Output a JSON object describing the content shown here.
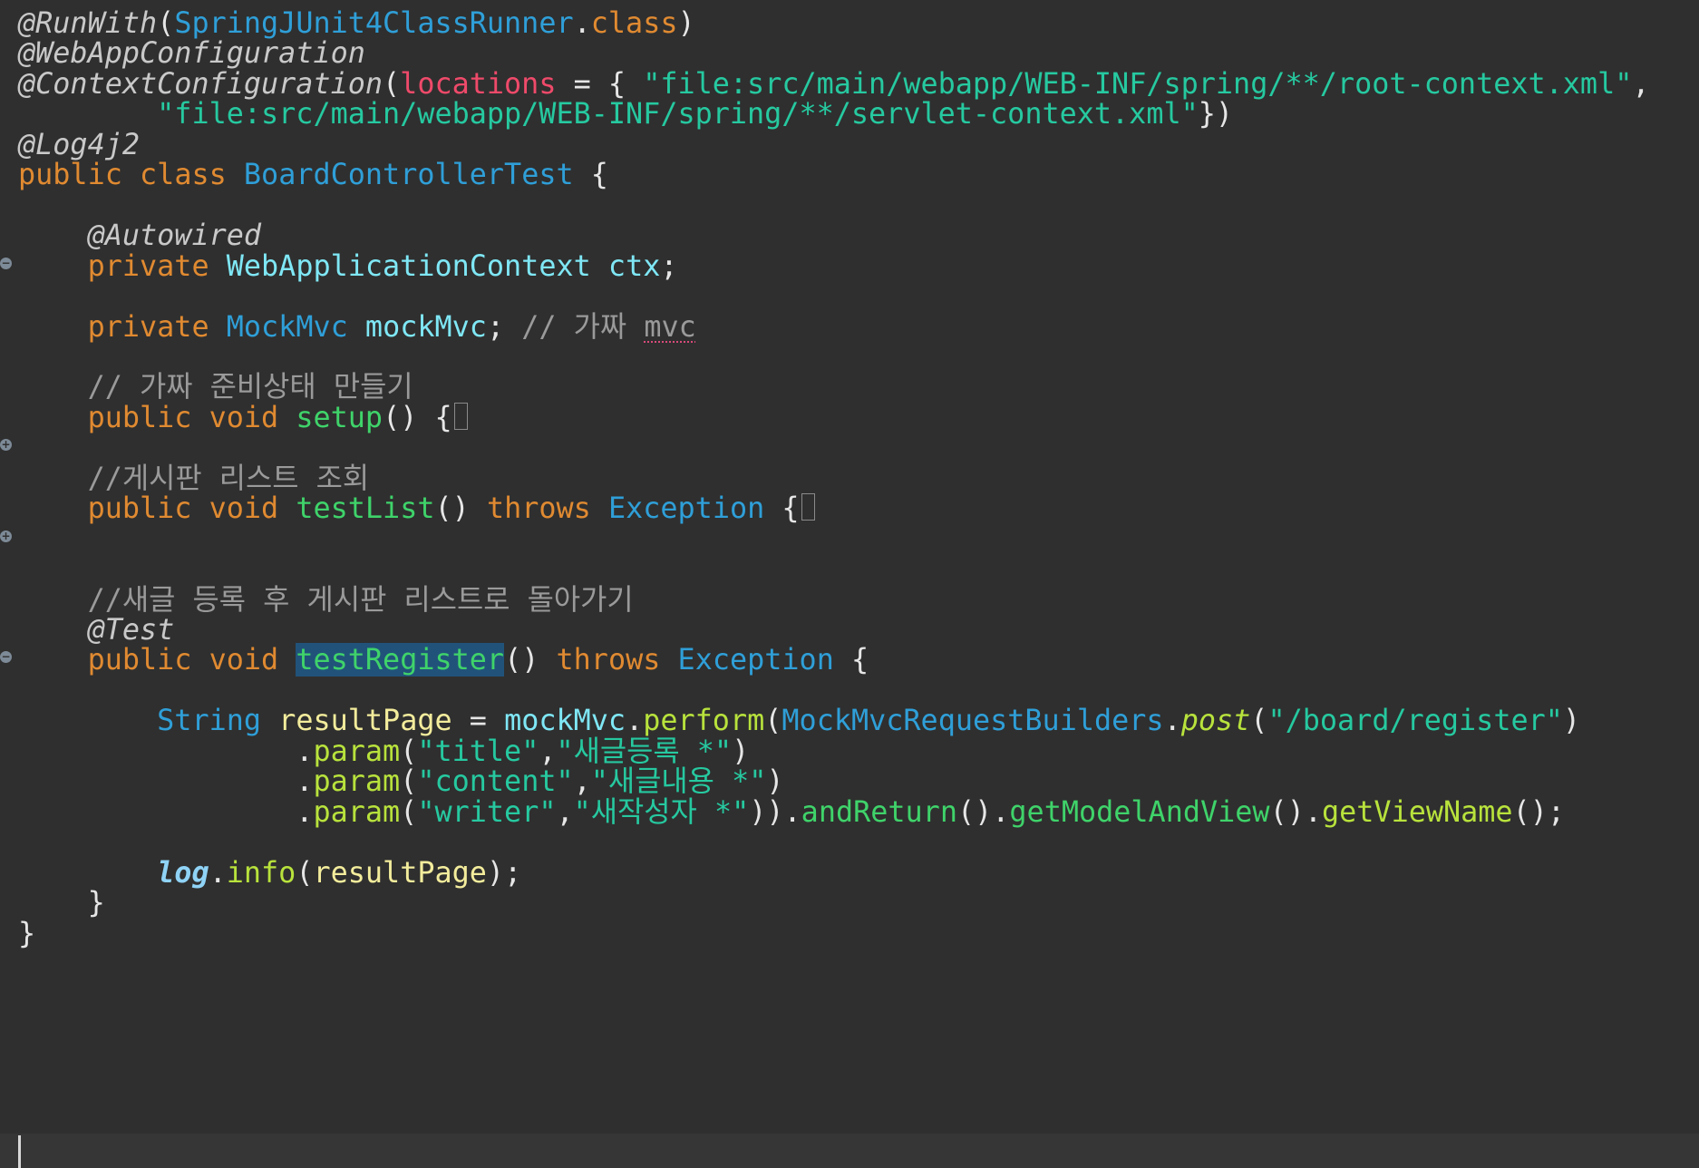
{
  "colors": {
    "background": "#2f2f2f",
    "annotation": "#c9c9c9",
    "keyword": "#e08a31",
    "type_blue": "#2f9fd8",
    "type_cyan": "#7fe7f5",
    "string": "#26c9a0",
    "method_green": "#3fd36a",
    "method_lime": "#b8e23c",
    "comment": "#9a9a9a",
    "attribute_red": "#ef4a6a",
    "plain": "#e6e6e6",
    "variable_yellow": "#f3ec9c",
    "static_field": "#8fd3f6",
    "selection": "#21537a"
  },
  "folds": [
    {
      "line": 8,
      "symbol": "−"
    },
    {
      "line": 14,
      "symbol": "+"
    },
    {
      "line": 17,
      "symbol": "+"
    },
    {
      "line": 21,
      "symbol": "−"
    }
  ],
  "lines": [
    [
      {
        "t": "@RunWith",
        "c": "annotation",
        "i": 1
      },
      {
        "t": "(",
        "c": "plain"
      },
      {
        "t": "SpringJUnit4ClassRunner",
        "c": "type_blue"
      },
      {
        "t": ".",
        "c": "plain"
      },
      {
        "t": "class",
        "c": "keyword"
      },
      {
        "t": ")",
        "c": "plain"
      }
    ],
    [
      {
        "t": "@WebAppConfiguration",
        "c": "annotation",
        "i": 1
      }
    ],
    [
      {
        "t": "@ContextConfiguration",
        "c": "annotation",
        "i": 1
      },
      {
        "t": "(",
        "c": "plain"
      },
      {
        "t": "locations",
        "c": "attribute_red"
      },
      {
        "t": " = { ",
        "c": "plain"
      },
      {
        "t": "\"file:src/main/webapp/WEB-INF/spring/**/root-context.xml\"",
        "c": "string"
      },
      {
        "t": ",",
        "c": "plain"
      }
    ],
    [
      {
        "t": "        ",
        "c": "plain"
      },
      {
        "t": "\"file:src/main/webapp/WEB-INF/spring/**/servlet-context.xml\"",
        "c": "string"
      },
      {
        "t": "})",
        "c": "plain"
      }
    ],
    [
      {
        "t": "@Log4j2",
        "c": "annotation",
        "i": 1
      }
    ],
    [
      {
        "t": "public",
        "c": "keyword"
      },
      {
        "t": " ",
        "c": "plain"
      },
      {
        "t": "class",
        "c": "keyword"
      },
      {
        "t": " ",
        "c": "plain"
      },
      {
        "t": "BoardControllerTest",
        "c": "type_blue"
      },
      {
        "t": " {",
        "c": "plain"
      }
    ],
    [],
    [
      {
        "t": "    ",
        "c": "plain"
      },
      {
        "t": "@Autowired",
        "c": "annotation",
        "i": 1
      }
    ],
    [
      {
        "t": "    ",
        "c": "plain"
      },
      {
        "t": "private",
        "c": "keyword"
      },
      {
        "t": " ",
        "c": "plain"
      },
      {
        "t": "WebApplicationContext",
        "c": "type_cyan"
      },
      {
        "t": " ",
        "c": "plain"
      },
      {
        "t": "ctx",
        "c": "type_cyan"
      },
      {
        "t": ";",
        "c": "plain"
      }
    ],
    [],
    [
      {
        "t": "    ",
        "c": "plain"
      },
      {
        "t": "private",
        "c": "keyword"
      },
      {
        "t": " ",
        "c": "plain"
      },
      {
        "t": "MockMvc",
        "c": "type_blue"
      },
      {
        "t": " ",
        "c": "plain"
      },
      {
        "t": "mockMvc",
        "c": "type_cyan"
      },
      {
        "t": "; ",
        "c": "plain"
      },
      {
        "t": "// 가짜 ",
        "c": "comment"
      },
      {
        "t": "mvc",
        "c": "comment",
        "sq": 1
      }
    ],
    [],
    [
      {
        "t": "    ",
        "c": "plain"
      },
      {
        "t": "// 가짜 준비상태 만들기",
        "c": "comment"
      }
    ],
    [
      {
        "t": "    ",
        "c": "plain"
      },
      {
        "t": "public",
        "c": "keyword"
      },
      {
        "t": " ",
        "c": "plain"
      },
      {
        "t": "void",
        "c": "keyword"
      },
      {
        "t": " ",
        "c": "plain"
      },
      {
        "t": "setup",
        "c": "method_green"
      },
      {
        "t": "() {",
        "c": "plain"
      },
      {
        "box": 1
      }
    ],
    [],
    [
      {
        "t": "    ",
        "c": "plain"
      },
      {
        "t": "//게시판 리스트 조회",
        "c": "comment"
      }
    ],
    [
      {
        "t": "    ",
        "c": "plain"
      },
      {
        "t": "public",
        "c": "keyword"
      },
      {
        "t": " ",
        "c": "plain"
      },
      {
        "t": "void",
        "c": "keyword"
      },
      {
        "t": " ",
        "c": "plain"
      },
      {
        "t": "testList",
        "c": "method_green"
      },
      {
        "t": "() ",
        "c": "plain"
      },
      {
        "t": "throws",
        "c": "keyword"
      },
      {
        "t": " ",
        "c": "plain"
      },
      {
        "t": "Exception",
        "c": "type_blue"
      },
      {
        "t": " {",
        "c": "plain"
      },
      {
        "box": 1
      }
    ],
    [],
    [],
    [
      {
        "t": "    ",
        "c": "plain"
      },
      {
        "t": "//새글 등록 후 게시판 리스트로 돌아가기",
        "c": "comment"
      }
    ],
    [
      {
        "t": "    ",
        "c": "plain"
      },
      {
        "t": "@Test",
        "c": "annotation",
        "i": 1
      }
    ],
    [
      {
        "t": "    ",
        "c": "plain"
      },
      {
        "t": "public",
        "c": "keyword"
      },
      {
        "t": " ",
        "c": "plain"
      },
      {
        "t": "void",
        "c": "keyword"
      },
      {
        "t": " ",
        "c": "plain"
      },
      {
        "t": "testRegister",
        "c": "method_green",
        "sel": 1
      },
      {
        "t": "() ",
        "c": "plain"
      },
      {
        "t": "throws",
        "c": "keyword"
      },
      {
        "t": " ",
        "c": "plain"
      },
      {
        "t": "Exception",
        "c": "type_blue"
      },
      {
        "t": " {",
        "c": "plain"
      }
    ],
    [],
    [
      {
        "t": "        ",
        "c": "plain"
      },
      {
        "t": "String",
        "c": "type_blue"
      },
      {
        "t": " ",
        "c": "plain"
      },
      {
        "t": "resultPage",
        "c": "variable_yellow"
      },
      {
        "t": " = ",
        "c": "plain"
      },
      {
        "t": "mockMvc",
        "c": "type_cyan"
      },
      {
        "t": ".",
        "c": "plain"
      },
      {
        "t": "perform",
        "c": "method_lime"
      },
      {
        "t": "(",
        "c": "plain"
      },
      {
        "t": "MockMvcRequestBuilders",
        "c": "type_blue"
      },
      {
        "t": ".",
        "c": "plain"
      },
      {
        "t": "post",
        "c": "method_lime",
        "i": 1
      },
      {
        "t": "(",
        "c": "plain"
      },
      {
        "t": "\"/board/register\"",
        "c": "string"
      },
      {
        "t": ")",
        "c": "plain"
      }
    ],
    [
      {
        "t": "                ",
        "c": "plain"
      },
      {
        "t": ".",
        "c": "plain"
      },
      {
        "t": "param",
        "c": "method_lime"
      },
      {
        "t": "(",
        "c": "plain"
      },
      {
        "t": "\"title\"",
        "c": "string"
      },
      {
        "t": ",",
        "c": "plain"
      },
      {
        "t": "\"새글등록 *\"",
        "c": "string"
      },
      {
        "t": ")",
        "c": "plain"
      }
    ],
    [
      {
        "t": "                ",
        "c": "plain"
      },
      {
        "t": ".",
        "c": "plain"
      },
      {
        "t": "param",
        "c": "method_lime"
      },
      {
        "t": "(",
        "c": "plain"
      },
      {
        "t": "\"content\"",
        "c": "string"
      },
      {
        "t": ",",
        "c": "plain"
      },
      {
        "t": "\"새글내용 *\"",
        "c": "string"
      },
      {
        "t": ")",
        "c": "plain"
      }
    ],
    [
      {
        "t": "                ",
        "c": "plain"
      },
      {
        "t": ".",
        "c": "plain"
      },
      {
        "t": "param",
        "c": "method_lime"
      },
      {
        "t": "(",
        "c": "plain"
      },
      {
        "t": "\"writer\"",
        "c": "string"
      },
      {
        "t": ",",
        "c": "plain"
      },
      {
        "t": "\"새작성자 *\"",
        "c": "string"
      },
      {
        "t": ")).",
        "c": "plain"
      },
      {
        "t": "andReturn",
        "c": "method_green"
      },
      {
        "t": "().",
        "c": "plain"
      },
      {
        "t": "getModelAndView",
        "c": "method_green"
      },
      {
        "t": "().",
        "c": "plain"
      },
      {
        "t": "getViewName",
        "c": "method_lime"
      },
      {
        "t": "();",
        "c": "plain"
      }
    ],
    [],
    [
      {
        "t": "        ",
        "c": "plain"
      },
      {
        "t": "log",
        "c": "static_field",
        "i": 1,
        "b": 1
      },
      {
        "t": ".",
        "c": "plain"
      },
      {
        "t": "info",
        "c": "method_lime"
      },
      {
        "t": "(",
        "c": "plain"
      },
      {
        "t": "resultPage",
        "c": "variable_yellow"
      },
      {
        "t": ");",
        "c": "plain"
      }
    ],
    [
      {
        "t": "    }",
        "c": "plain"
      }
    ],
    [
      {
        "t": "}",
        "c": "plain"
      }
    ]
  ]
}
